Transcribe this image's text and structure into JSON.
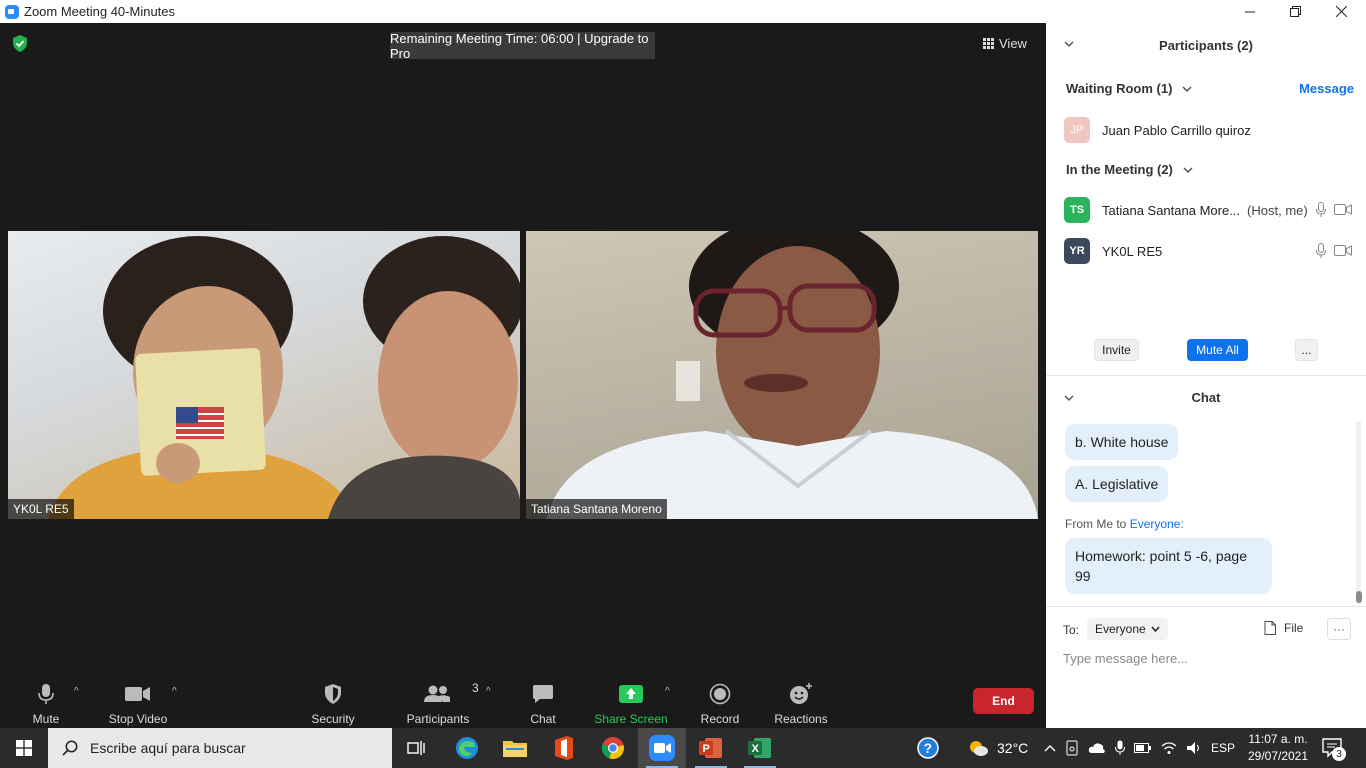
{
  "window": {
    "title": "Zoom Meeting 40-Minutes"
  },
  "meeting": {
    "timer_text": "Remaining Meeting Time: 06:00 | Upgrade to Pro",
    "view_label": "View",
    "tiles": [
      {
        "name": "YK0L RE5"
      },
      {
        "name": "Tatiana Santana Moreno"
      }
    ]
  },
  "toolbar": {
    "mute": "Mute",
    "stop_video": "Stop Video",
    "security": "Security",
    "participants": "Participants",
    "participants_count": "3",
    "chat": "Chat",
    "share_screen": "Share Screen",
    "record": "Record",
    "reactions": "Reactions",
    "end": "End"
  },
  "panel": {
    "title": "Participants (2)",
    "waiting_room": "Waiting Room (1)",
    "message_link": "Message",
    "waiting": [
      {
        "initials": "JP",
        "name": "Juan Pablo Carrillo quiroz",
        "color": "#f2c6c0"
      }
    ],
    "in_meeting_label": "In the Meeting (2)",
    "in_meeting": [
      {
        "initials": "TS",
        "name": "Tatiana Santana More...",
        "role": "(Host, me)",
        "color": "#2bb45a"
      },
      {
        "initials": "YR",
        "name": "YK0L RE5",
        "role": "",
        "color": "#3a4a5c"
      }
    ],
    "buttons": {
      "invite": "Invite",
      "mute_all": "Mute All",
      "more": "..."
    }
  },
  "chat": {
    "title": "Chat",
    "messages": [
      {
        "text": "b. White house"
      },
      {
        "text": "A. Legislative"
      },
      {
        "text": "Homework: point 5 -6, page 99"
      }
    ],
    "from_prefix": "From Me to",
    "from_target": "Everyone:",
    "to_label": "To:",
    "to_value": "Everyone",
    "file_label": "File",
    "more_label": "···",
    "input_placeholder": "Type message here..."
  },
  "taskbar": {
    "search_placeholder": "Escribe aquí para buscar",
    "weather": "32°C",
    "language": "ESP",
    "time": "11:07 a. m.",
    "date": "29/07/2021",
    "notifications": "3"
  }
}
